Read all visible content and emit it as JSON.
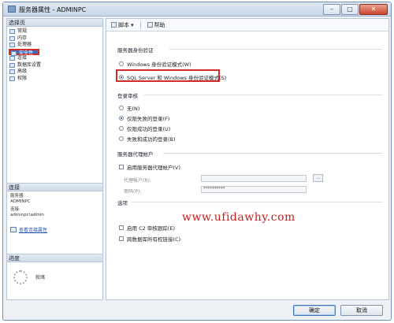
{
  "window": {
    "title": "服务器属性 - ADMINPC",
    "controls": {
      "minimize": "–",
      "maximize": "□",
      "close": "✕"
    }
  },
  "left_panel": {
    "select_page_header": "选择页",
    "pages": [
      {
        "label": "常规",
        "icon": "page-icon"
      },
      {
        "label": "内存",
        "icon": "page-icon"
      },
      {
        "label": "处理器",
        "icon": "page-icon"
      },
      {
        "label": "安全性",
        "icon": "page-icon",
        "selected": true
      },
      {
        "label": "连接",
        "icon": "page-icon"
      },
      {
        "label": "数据库设置",
        "icon": "page-icon"
      },
      {
        "label": "高级",
        "icon": "page-icon"
      },
      {
        "label": "权限",
        "icon": "page-icon"
      }
    ],
    "connection": {
      "header": "连接",
      "server_label": "服务器:",
      "server_value": "ADMINPC",
      "connection_label": "连接:",
      "connection_value": "adminpc\\admin",
      "view_link": "查看连接属性"
    },
    "progress": {
      "header": "进度",
      "status": "就绪"
    }
  },
  "toolbar": {
    "script_label": "脚本",
    "help_label": "帮助"
  },
  "security": {
    "auth_group_label": "服务器身份验证",
    "auth_windows": "Windows 身份验证模式(W)",
    "auth_mixed": "SQL Server 和 Windows 身份验证模式(S)",
    "selected_auth": "mixed",
    "login_audit_label": "登录审核",
    "audit_options": [
      "无(N)",
      "仅限失败的登录(F)",
      "仅限成功的登录(U)",
      "失败和成功的登录(B)"
    ],
    "audit_selected_index": 1,
    "proxy_group_label": "服务器代理帐户",
    "proxy_enable": "启用服务器代理帐户(V)",
    "proxy_account_label": "代理帐户(R):",
    "proxy_account_value": "",
    "proxy_password_label": "密码(P):",
    "proxy_password_value": "**********",
    "browse_button": "...",
    "options_group_label": "选项",
    "c2_audit": "启用 C2 审核跟踪(E)",
    "cross_db_chain": "跨数据库所有权链接(C)"
  },
  "watermark": "www.ufidawhy.com",
  "footer": {
    "ok_label": "确定",
    "cancel_label": "取消"
  },
  "colors": {
    "highlight_red": "#d52a2a",
    "selection_blue": "#3b6fc1",
    "watermark_red": "#c81d1d"
  }
}
